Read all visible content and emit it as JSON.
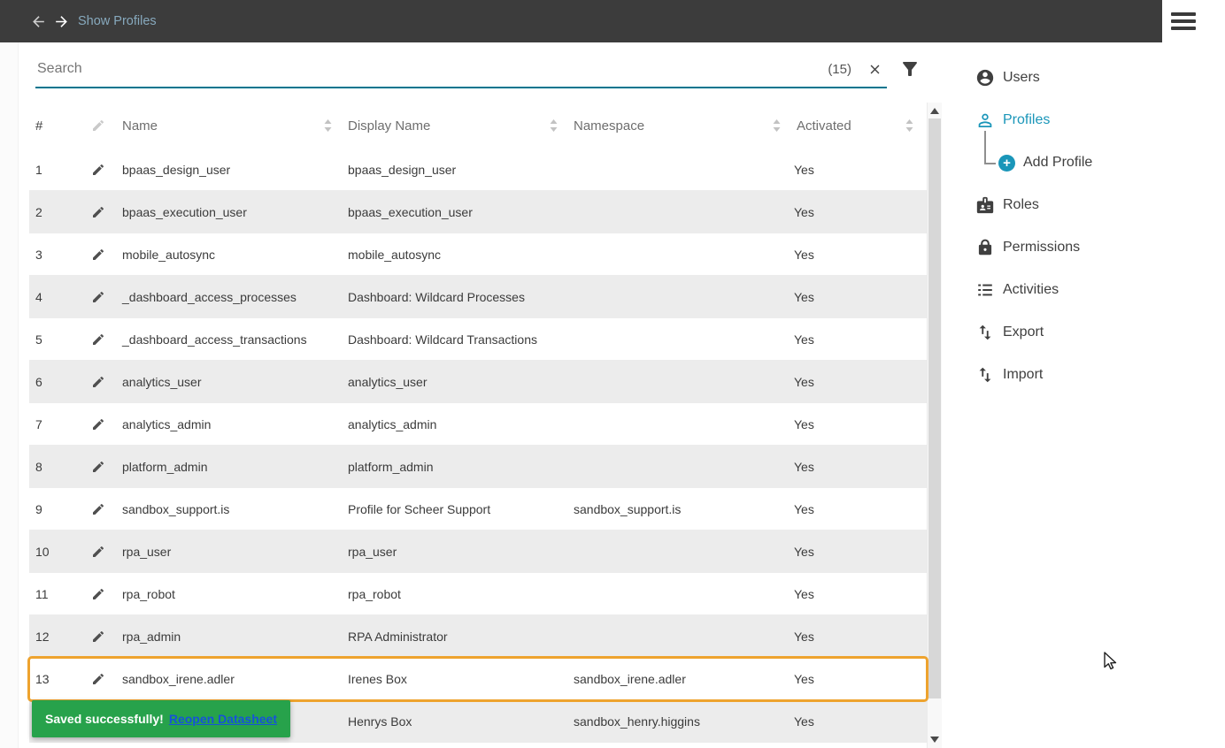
{
  "topbar": {
    "title": "Show Profiles"
  },
  "search": {
    "placeholder": "Search",
    "count": "(15)"
  },
  "table": {
    "headers": {
      "num": "#",
      "name": "Name",
      "display_name": "Display Name",
      "namespace": "Namespace",
      "activated": "Activated"
    },
    "rows": [
      {
        "num": "1",
        "name": "bpaas_design_user",
        "display_name": "bpaas_design_user",
        "namespace": "",
        "activated": "Yes"
      },
      {
        "num": "2",
        "name": "bpaas_execution_user",
        "display_name": "bpaas_execution_user",
        "namespace": "",
        "activated": "Yes"
      },
      {
        "num": "3",
        "name": "mobile_autosync",
        "display_name": "mobile_autosync",
        "namespace": "",
        "activated": "Yes"
      },
      {
        "num": "4",
        "name": "_dashboard_access_processes",
        "display_name": "Dashboard: Wildcard Processes",
        "namespace": "",
        "activated": "Yes"
      },
      {
        "num": "5",
        "name": "_dashboard_access_transactions",
        "display_name": "Dashboard: Wildcard Transactions",
        "namespace": "",
        "activated": "Yes"
      },
      {
        "num": "6",
        "name": "analytics_user",
        "display_name": "analytics_user",
        "namespace": "",
        "activated": "Yes"
      },
      {
        "num": "7",
        "name": "analytics_admin",
        "display_name": "analytics_admin",
        "namespace": "",
        "activated": "Yes"
      },
      {
        "num": "8",
        "name": "platform_admin",
        "display_name": "platform_admin",
        "namespace": "",
        "activated": "Yes"
      },
      {
        "num": "9",
        "name": "sandbox_support.is",
        "display_name": "Profile for Scheer Support",
        "namespace": "sandbox_support.is",
        "activated": "Yes"
      },
      {
        "num": "10",
        "name": "rpa_user",
        "display_name": "rpa_user",
        "namespace": "",
        "activated": "Yes"
      },
      {
        "num": "11",
        "name": "rpa_robot",
        "display_name": "rpa_robot",
        "namespace": "",
        "activated": "Yes"
      },
      {
        "num": "12",
        "name": "rpa_admin",
        "display_name": "RPA Administrator",
        "namespace": "",
        "activated": "Yes"
      },
      {
        "num": "13",
        "name": "sandbox_irene.adler",
        "display_name": "Irenes Box",
        "namespace": "sandbox_irene.adler",
        "activated": "Yes",
        "highlighted": true
      },
      {
        "num": "",
        "name": "",
        "display_name": "Henrys Box",
        "namespace": "sandbox_henry.higgins",
        "activated": "Yes"
      }
    ]
  },
  "toast": {
    "message": "Saved successfully!",
    "link_label": "Reopen Datasheet"
  },
  "sidebar": {
    "items": [
      {
        "label": "Users"
      },
      {
        "label": "Profiles",
        "active": true
      },
      {
        "label": "Add Profile",
        "child": true
      },
      {
        "label": "Roles"
      },
      {
        "label": "Permissions"
      },
      {
        "label": "Activities"
      },
      {
        "label": "Export"
      },
      {
        "label": "Import"
      }
    ]
  },
  "colors": {
    "accent": "#1a96b9",
    "underline": "#00758f",
    "toast_green": "#27a24b",
    "highlight_orange": "#eea32e",
    "link_blue": "#1652d9",
    "topbar_bg": "#3c3c3c",
    "topbar_title": "#87a9bd"
  }
}
